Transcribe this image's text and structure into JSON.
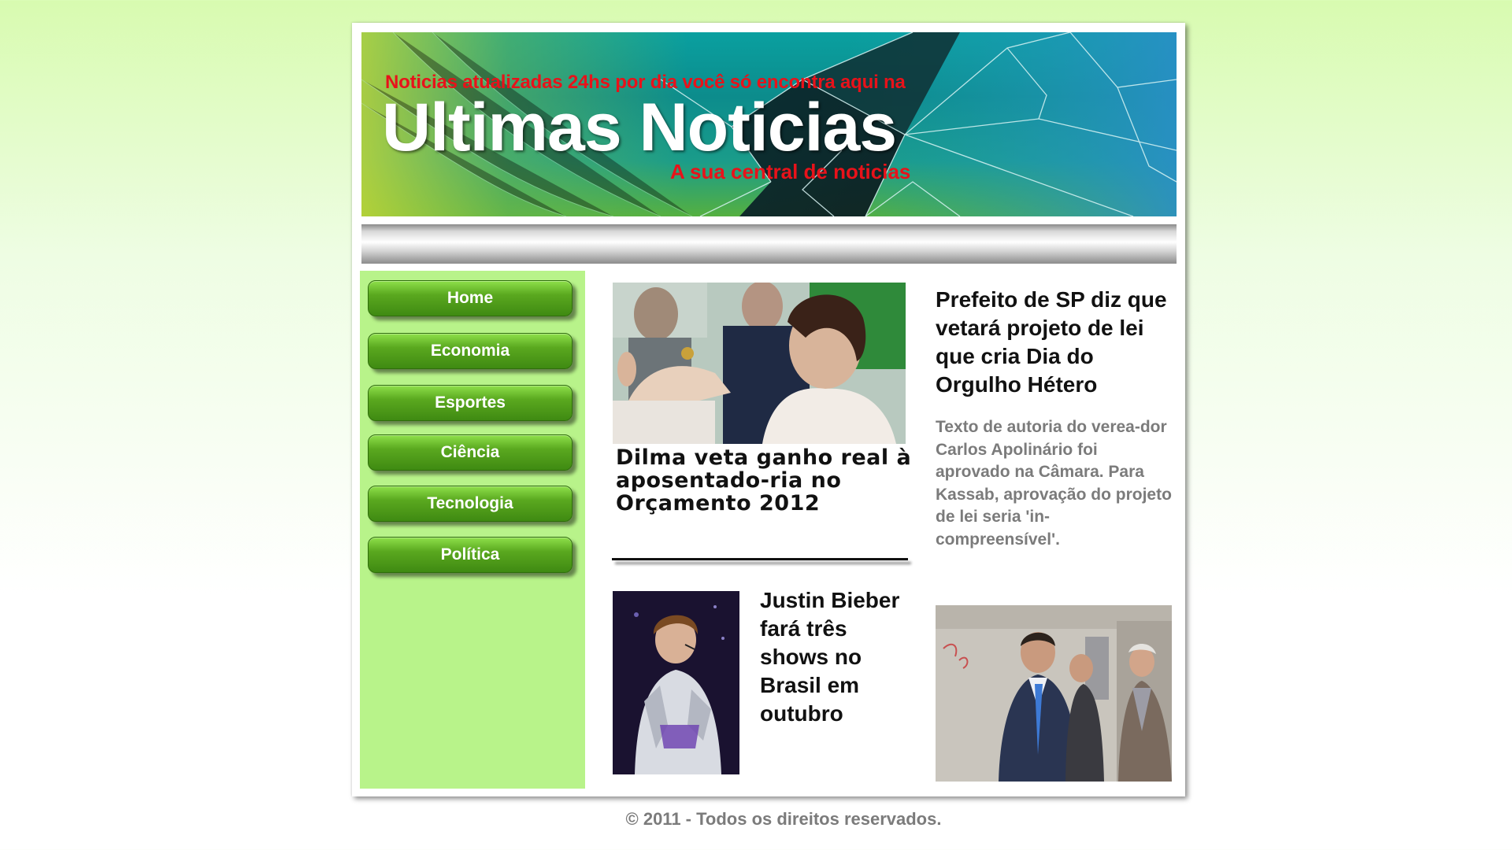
{
  "header": {
    "tagline": "Noticias atualizadas 24hs por dia você só encontra aqui na",
    "title": "Ultimas Noticias",
    "subtitle": "A sua central de noticias"
  },
  "sidebar": {
    "items": [
      {
        "label": "Home"
      },
      {
        "label": "Economia"
      },
      {
        "label": "Esportes"
      },
      {
        "label": "Ciência"
      },
      {
        "label": "Tecnologia"
      },
      {
        "label": "Política"
      }
    ]
  },
  "main": {
    "lead_headline": "Dilma veta ganho real à aposentado-ria no Orçamento 2012",
    "side_headline": "Prefeito de SP diz que vetará projeto de lei que cria Dia do Orgulho Hétero",
    "side_summary": "Texto de autoria do verea-dor Carlos Apolinário foi aprovado na Câmara. Para Kassab, aprovação do projeto de lei seria 'in-compreensível'.",
    "bieber_headline": "Justin Bieber fará três shows no Brasil em outubro"
  },
  "footer": {
    "copyright": "© 2011 - Todos os direitos reservados."
  },
  "colors": {
    "accent_red": "#e8121a",
    "sidebar_green": "#b8f38a",
    "button_green": "#4f9a18",
    "summary_gray": "#7b7b7b"
  }
}
